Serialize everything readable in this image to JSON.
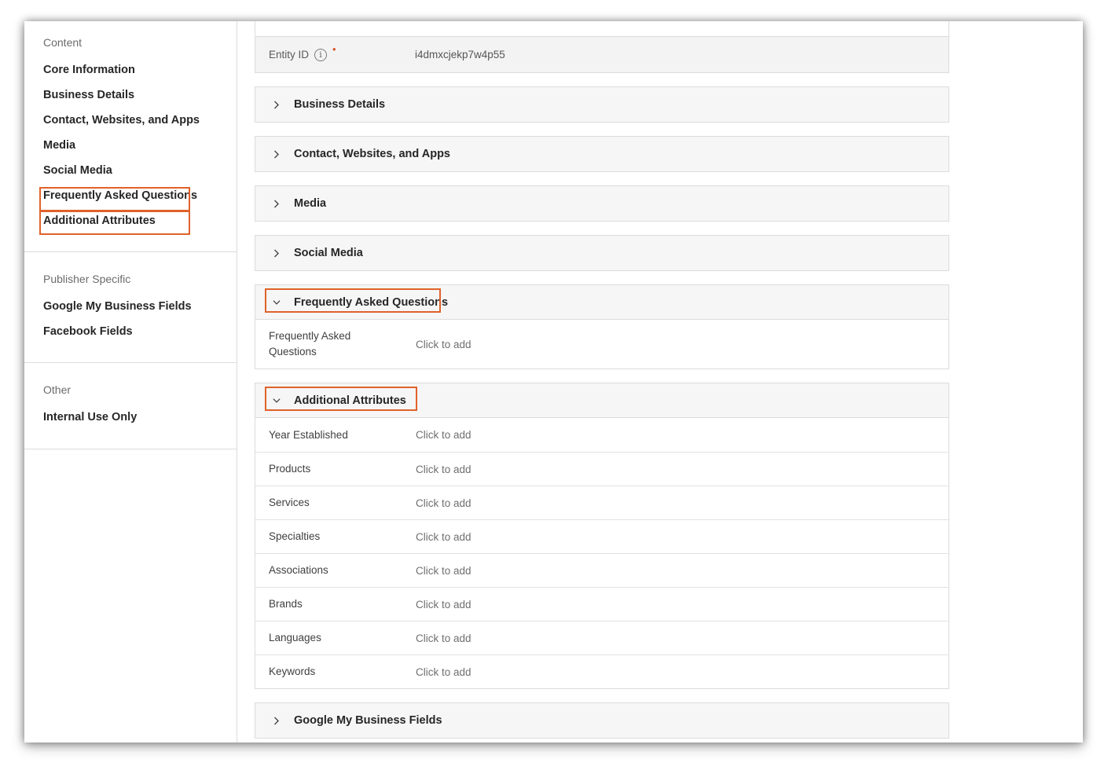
{
  "sidebar": {
    "sections": [
      {
        "heading": "Content",
        "items": [
          "Core Information",
          "Business Details",
          "Contact, Websites, and Apps",
          "Media",
          "Social Media",
          "Frequently Asked Questions",
          "Additional Attributes"
        ]
      },
      {
        "heading": "Publisher Specific",
        "items": [
          "Google My Business Fields",
          "Facebook Fields"
        ]
      },
      {
        "heading": "Other",
        "items": [
          "Internal Use Only"
        ]
      }
    ]
  },
  "entity": {
    "label": "Entity ID",
    "info_icon": "info-icon",
    "required_marker": "•",
    "value": "i4dmxcjekp7w4p55"
  },
  "panels": {
    "business_details": "Business Details",
    "contact": "Contact, Websites, and Apps",
    "media": "Media",
    "social_media": "Social Media",
    "faq": {
      "title": "Frequently Asked Questions",
      "fields": [
        {
          "label": "Frequently Asked Questions",
          "value": "Click to add"
        }
      ]
    },
    "additional": {
      "title": "Additional Attributes",
      "fields": [
        {
          "label": "Year Established",
          "value": "Click to add"
        },
        {
          "label": "Products",
          "value": "Click to add"
        },
        {
          "label": "Services",
          "value": "Click to add"
        },
        {
          "label": "Specialties",
          "value": "Click to add"
        },
        {
          "label": "Associations",
          "value": "Click to add"
        },
        {
          "label": "Brands",
          "value": "Click to add"
        },
        {
          "label": "Languages",
          "value": "Click to add"
        },
        {
          "label": "Keywords",
          "value": "Click to add"
        }
      ]
    },
    "gmb": "Google My Business Fields"
  },
  "colors": {
    "highlight": "#e0622a",
    "border": "#dcdcdc",
    "panel_bg": "#f6f6f6"
  }
}
